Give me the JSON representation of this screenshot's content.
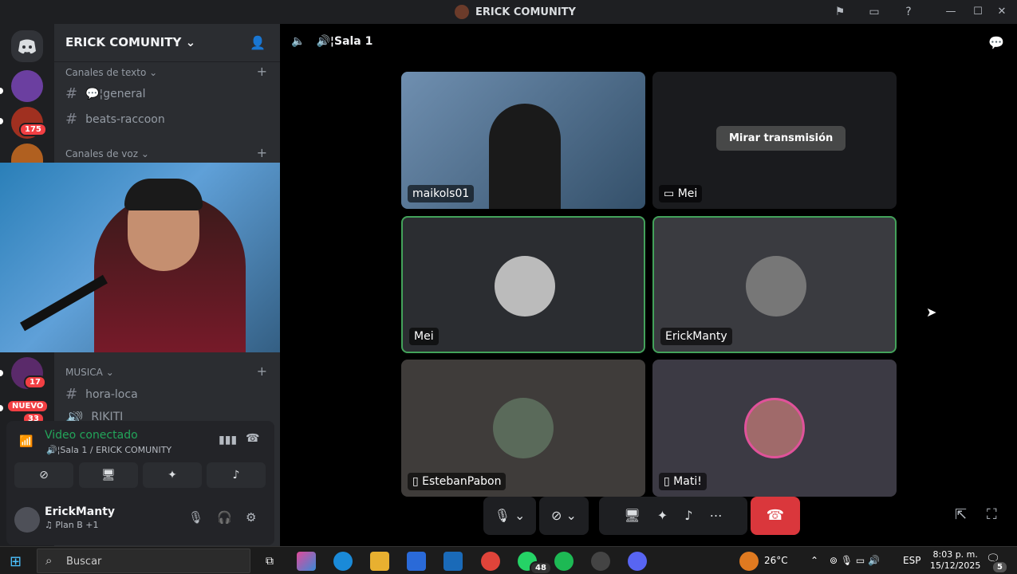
{
  "window": {
    "title": "ERICK COMUNITY"
  },
  "server_list": {
    "badges": [
      "175",
      "17",
      "NUEVO",
      "33"
    ]
  },
  "guild": {
    "name": "ERICK COMUNITY",
    "chevron": "⌄",
    "categories": [
      {
        "label": "Canales de texto ⌄"
      },
      {
        "label": "Canales de voz ⌄"
      },
      {
        "label": "MUSICA ⌄"
      }
    ],
    "text_channels": [
      {
        "name": "💬¦general"
      },
      {
        "name": "beats-raccoon"
      }
    ],
    "music_channels": [
      {
        "name": "hora-loca"
      },
      {
        "name": "RIKITI"
      }
    ]
  },
  "voice_panel": {
    "status": "Video conectado",
    "location": "🔊¦Sala 1 / ERICK COMUNITY"
  },
  "user": {
    "name": "ErickManty",
    "status": "♫ Plan B +1"
  },
  "main": {
    "channel_title": "🔊¦Sala 1",
    "tiles": [
      {
        "label": "maikols01"
      },
      {
        "label": "Mei",
        "button": "Mirar transmisión"
      },
      {
        "label": "Mei"
      },
      {
        "label": "ErickManty"
      },
      {
        "label": "EstebanPabon"
      },
      {
        "label": "Mati!"
      }
    ]
  },
  "taskbar": {
    "search_placeholder": "Buscar",
    "whatsapp_badge": "48",
    "weather": "26°C",
    "lang": "ESP",
    "time": "8:03 p. m.",
    "date": "15/12/2025",
    "notif_badge": "5"
  },
  "icons": {
    "discord": "discord-icon",
    "mic": "microphone-icon",
    "headphones": "headphones-icon",
    "gear": "gear-icon"
  },
  "colors": {
    "speaking_border": "#43a25a",
    "hangup": "#da373c",
    "connected": "#23a55a"
  }
}
